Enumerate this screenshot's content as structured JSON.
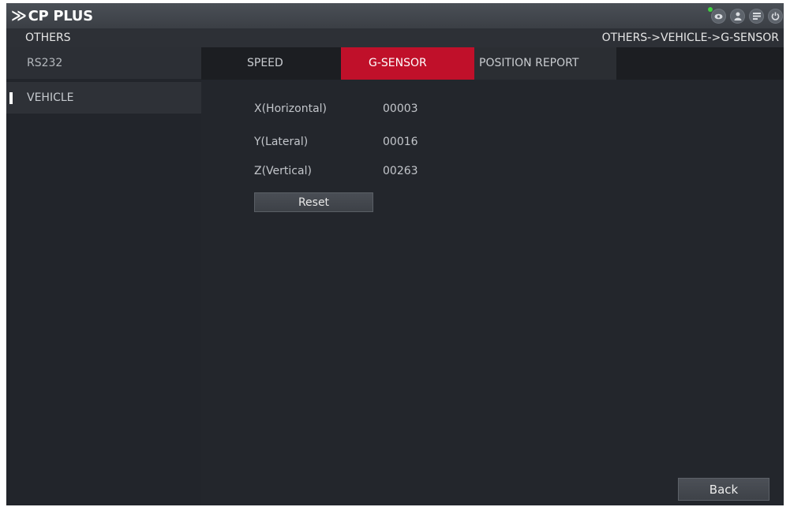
{
  "app": {
    "logo_text": "CP PLUS",
    "logo_mark": "≫"
  },
  "topbar": {
    "icons": [
      {
        "name": "eye-icon",
        "glyph": "●"
      },
      {
        "name": "user-icon",
        "glyph": "●"
      },
      {
        "name": "list-icon",
        "glyph": "▤"
      },
      {
        "name": "power-icon",
        "glyph": "⏻"
      }
    ],
    "status_color": "#3fd13f"
  },
  "header": {
    "section_title": "OTHERS",
    "breadcrumb": "OTHERS->VEHICLE->G-SENSOR"
  },
  "sidebar": {
    "items": [
      {
        "label": "RS232"
      },
      {
        "label": "VEHICLE",
        "selected": true
      }
    ]
  },
  "tabs": [
    {
      "label": "SPEED"
    },
    {
      "label": "G-SENSOR",
      "active": true
    },
    {
      "label": "POSITION REPORT"
    }
  ],
  "gsensor": {
    "fields": [
      {
        "label": "X(Horizontal)",
        "value": "00003"
      },
      {
        "label": "Y(Lateral)",
        "value": "00016"
      },
      {
        "label": "Z(Vertical)",
        "value": "00263"
      }
    ],
    "reset_label": "Reset"
  },
  "footer": {
    "back_label": "Back"
  },
  "colors": {
    "accent": "#c0102a",
    "background": "#23262c"
  }
}
